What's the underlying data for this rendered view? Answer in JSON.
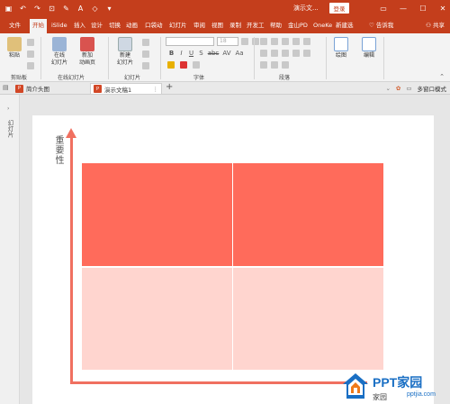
{
  "titlebar": {
    "doc_title": "演示文...",
    "login": "登录",
    "qat_icons": [
      "save-icon",
      "undo-icon",
      "redo-icon",
      "slideshow-icon"
    ]
  },
  "tabs": [
    {
      "label": "文件"
    },
    {
      "label": "开始"
    },
    {
      "label": "iSlide"
    },
    {
      "label": "插入"
    },
    {
      "label": "设计"
    },
    {
      "label": "切换"
    },
    {
      "label": "动画"
    },
    {
      "label": "口袋动"
    },
    {
      "label": "幻灯片"
    },
    {
      "label": "审阅"
    },
    {
      "label": "视图"
    },
    {
      "label": "录制"
    },
    {
      "label": "开发工"
    },
    {
      "label": "帮助"
    },
    {
      "label": "金山PD"
    },
    {
      "label": "OneKe"
    },
    {
      "label": "新建选"
    }
  ],
  "tell_me": "告诉我",
  "share": "共享",
  "ribbon": {
    "paste": "粘贴",
    "clipboard": "剪贴板",
    "online_slide": "在线\n幻灯片",
    "new_anim_page": "新加\n动画页",
    "online_group": "在线幻灯片",
    "new_slide": "新建\n幻灯片",
    "slides_group": "幻灯片",
    "font_group": "字体",
    "font_size": "18",
    "paragraph_group": "段落",
    "drawing": "绘图",
    "editing": "编辑",
    "fmt": [
      "B",
      "I",
      "U",
      "S",
      "abc",
      "AV",
      "Aa"
    ]
  },
  "doc_tabs": [
    {
      "label": "简介头图",
      "icon": "P"
    },
    {
      "label": "演示文稿1",
      "icon": "P"
    }
  ],
  "doc_right": {
    "multi_window": "多窗口模式"
  },
  "left_pane": {
    "label": "幻灯片"
  },
  "slide": {
    "y_axis_label": "重要性"
  },
  "watermark": {
    "brand": "PPT家园",
    "url": "pptjia.com",
    "cn": "家园"
  },
  "colors": {
    "titlebar": "#c43e1c",
    "quad_top": "#ff6b5b",
    "quad_bottom": "#ffd5cf",
    "axis": "#f07060"
  }
}
